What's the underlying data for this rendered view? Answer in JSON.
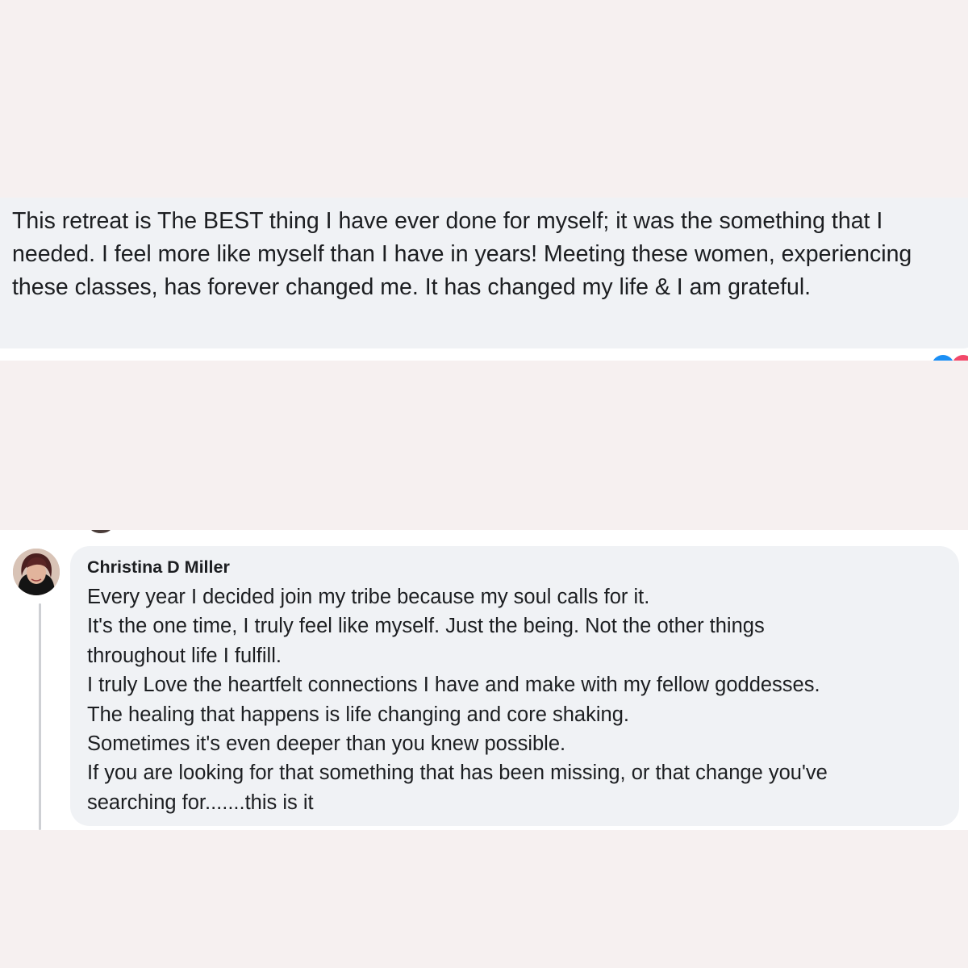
{
  "top_comment": {
    "text": "This retreat is The BEST thing I have ever done for myself; it was the something that I needed. I feel more like myself than I have in years! Meeting these women, experiencing these classes, has forever changed me. It has changed my life & I am grateful.",
    "reactions": [
      "like-icon",
      "love-icon"
    ]
  },
  "bottom_comment": {
    "author": "Christina D Miller",
    "lines": [
      "Every year I decided join my tribe because my soul calls for it.",
      "It's the one time, I truly feel like myself. Just the being. Not the other things",
      "throughout life I fulfill.",
      "I truly Love the heartfelt connections I have and make with my fellow goddesses.",
      "The healing that happens is life changing and core shaking.",
      "Sometimes it's even deeper than you knew possible.",
      "If you are looking for that something that has been missing, or that change you've",
      "searching for.......this is it"
    ]
  },
  "colors": {
    "page_background": "#f6f0f0",
    "bubble_background": "#f0f2f5",
    "text": "#1c1e21",
    "like_blue": "#1b8ff5",
    "love_pink": "#f2496a"
  }
}
